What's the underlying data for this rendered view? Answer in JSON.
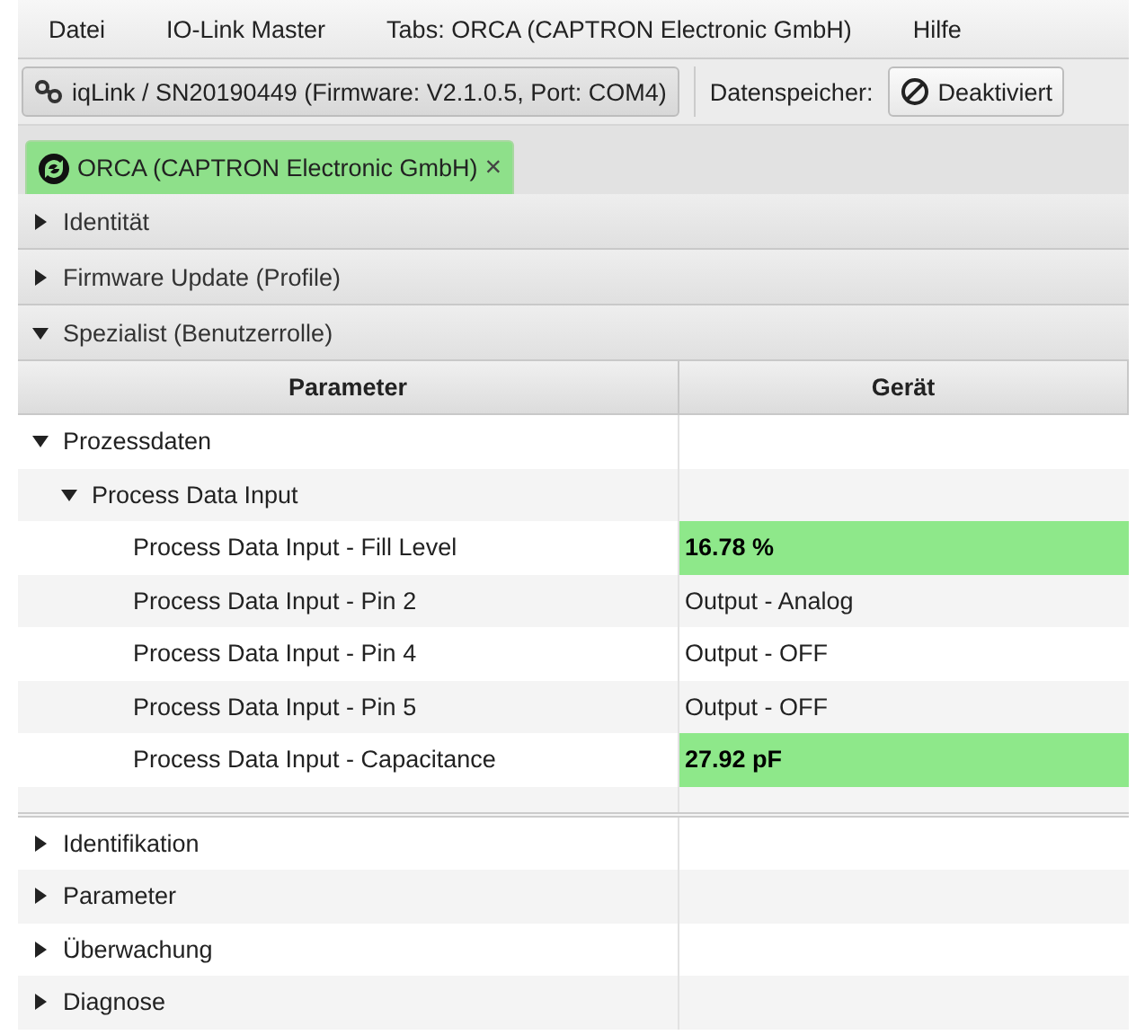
{
  "menu": [
    "Datei",
    "IO-Link Master",
    "Tabs: ORCA (CAPTRON Electronic GmbH)",
    "Hilfe"
  ],
  "toolbar": {
    "connection": "iqLink / SN20190449 (Firmware: V2.1.0.5, Port: COM4)",
    "datastore_label": "Datenspeicher:",
    "datastore_button": "Deaktiviert"
  },
  "tabs": [
    {
      "label": "ORCA (CAPTRON Electronic GmbH)",
      "close": "×",
      "selected": true
    }
  ],
  "sections": [
    {
      "label": "Identität",
      "expanded": false
    },
    {
      "label": "Firmware Update (Profile)",
      "expanded": false
    },
    {
      "label": "Spezialist (Benutzerrolle)",
      "expanded": true
    }
  ],
  "table": {
    "columns": [
      "Parameter",
      "Gerät"
    ],
    "rows": [
      {
        "label": "Prozessdaten",
        "expanded": true,
        "children": [
          {
            "label": "Process Data Input",
            "expanded": true,
            "children": [
              {
                "label": "Process Data Input - Fill Level",
                "value": "16.78 %",
                "highlight": true
              },
              {
                "label": "Process Data Input - Pin 2",
                "value": "Output - Analog",
                "highlight": false
              },
              {
                "label": "Process Data Input - Pin 4",
                "value": "Output - OFF",
                "highlight": false
              },
              {
                "label": "Process Data Input - Pin 5",
                "value": "Output - OFF",
                "highlight": false
              },
              {
                "label": "Process Data Input - Capacitance",
                "value": "27.92 pF",
                "highlight": true
              }
            ]
          }
        ]
      }
    ]
  },
  "lower_tree": [
    {
      "label": "Identifikation",
      "expanded": false
    },
    {
      "label": "Parameter",
      "expanded": false
    },
    {
      "label": "Überwachung",
      "expanded": false
    },
    {
      "label": "Diagnose",
      "expanded": false
    }
  ]
}
